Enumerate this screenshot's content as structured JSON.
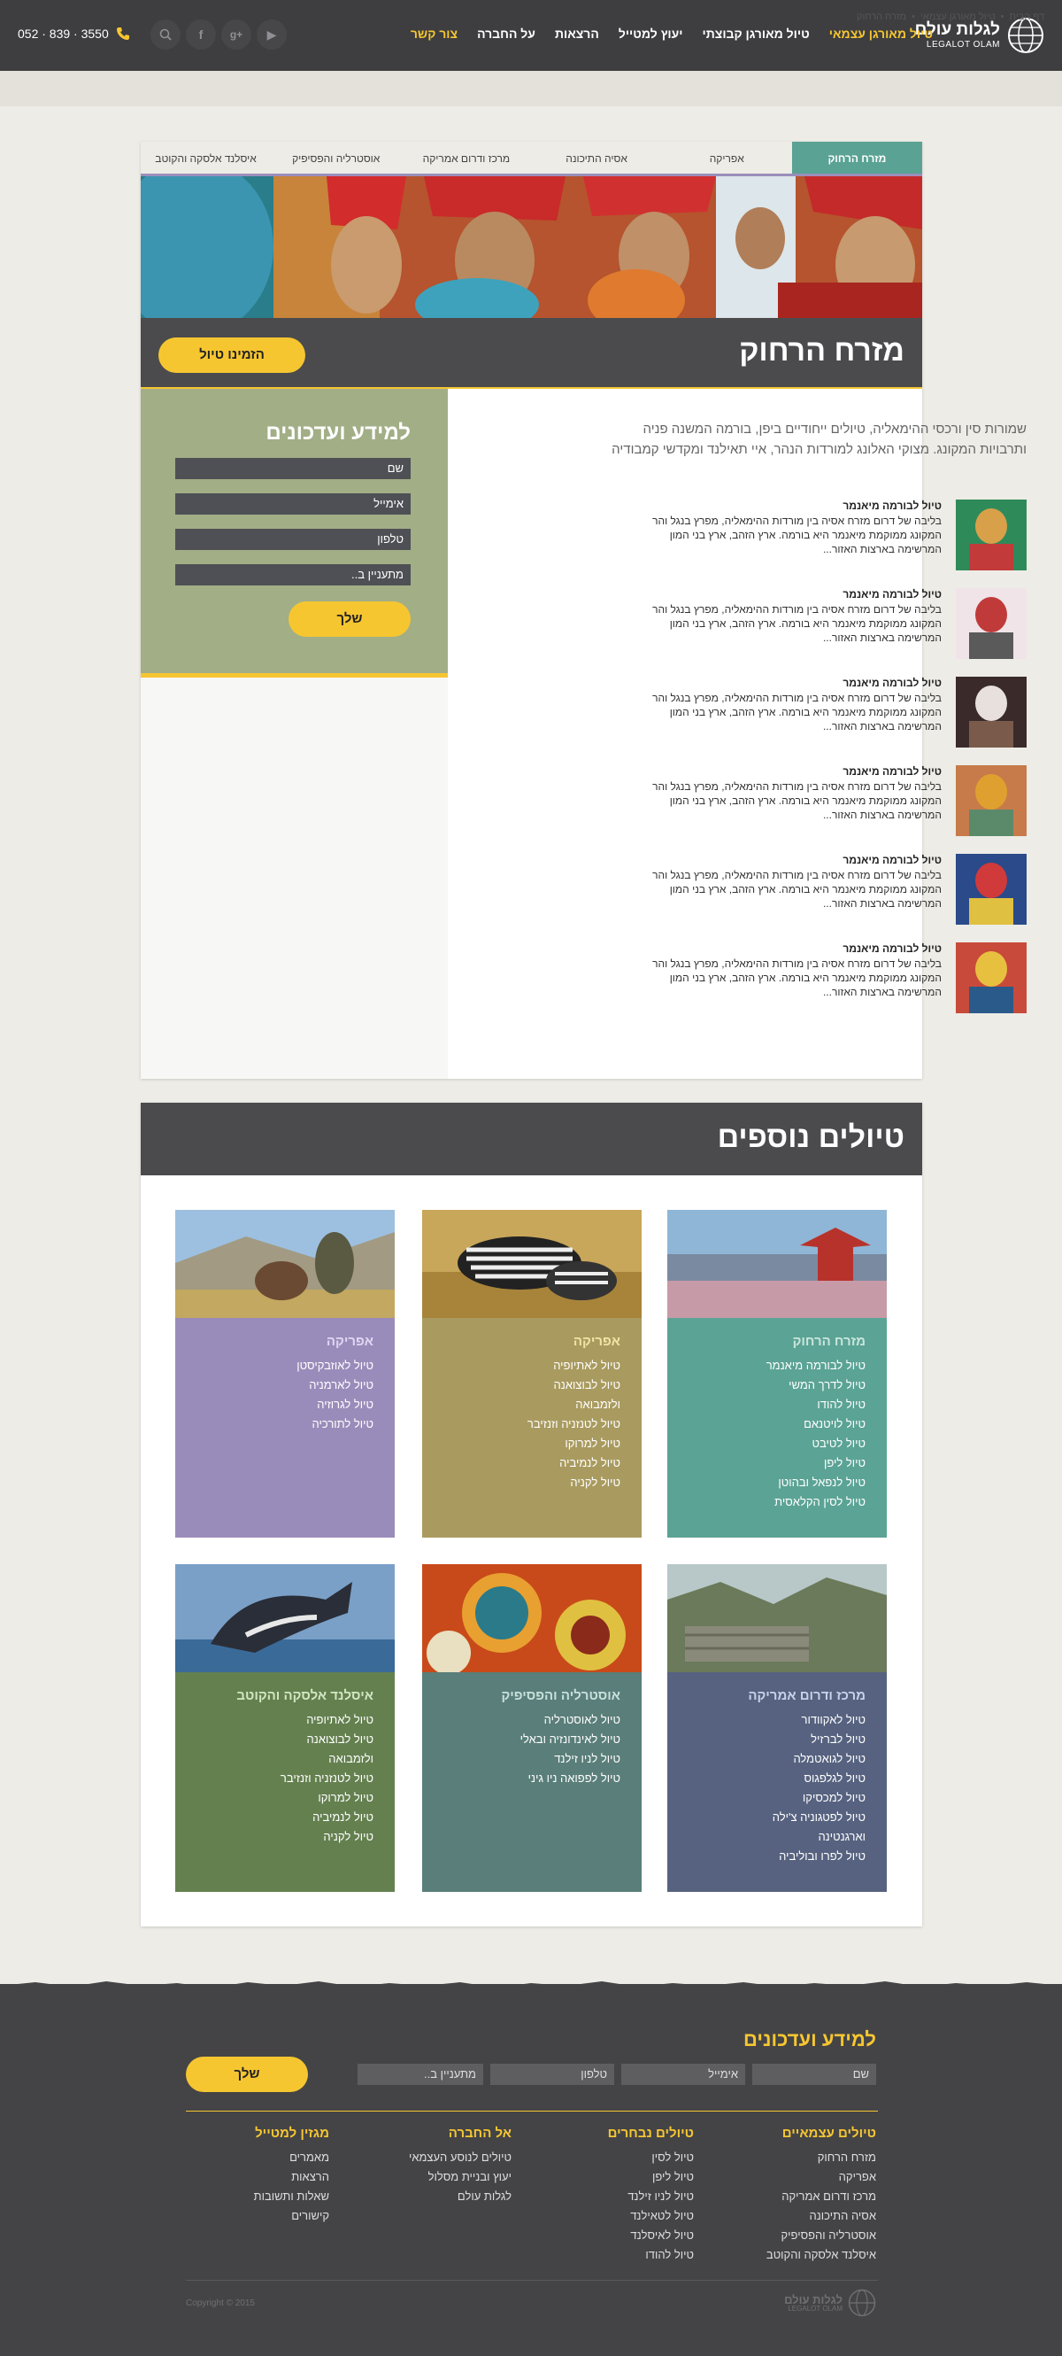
{
  "header": {
    "logo_he": "לגלות עולם",
    "logo_en": "LEGALOT OLAM",
    "nav": [
      "טיול מאורגן עצמאי",
      "טיול מאורגן קבוצתי",
      "יעוץ למטייל",
      "הרצאות",
      "על החברה",
      "צור קשר"
    ],
    "phone": "052 · 839 · 3550",
    "social": [
      "search-icon",
      "facebook-icon",
      "google-plus-icon",
      "youtube-icon"
    ]
  },
  "breadcrumb": [
    "דף הבית",
    "טיול מאורגן עצמאי",
    "מזרח הרחוק"
  ],
  "tabs": [
    "מזרח הרחוק",
    "אפריקה",
    "אסיה התיכונה",
    "מרכז ודרום אמריקה",
    "אוסטרליה והפסיפיק",
    "איסלנד אלסקה והקוטב"
  ],
  "page": {
    "title": "מזרח הרחוק",
    "book_label": "הזמינו טיול",
    "intro": "שמורות סין ורכסי ההימאליה, טיולים ייחודיים ביפן, בורמה המשנה פניה ותרבויות המקונג. מצוקי האלונג למורדות הנהר, איי תאילנד ומקדשי קמבודיה"
  },
  "tour_items": [
    {
      "title": "טיול לבורמה מיאנמר",
      "desc": "בליבה של דרום מזרח אסיה בין מורדות ההימאליה, מפרץ בנגל והר המקונג ממוקמת מיאנמר היא בורמה. ארץ הזהב, ארץ בני המון המרשימה בארצות האזור..."
    },
    {
      "title": "טיול לבורמה מיאנמר",
      "desc": "בליבה של דרום מזרח אסיה בין מורדות ההימאליה, מפרץ בנגל והר המקונג ממוקמת מיאנמר היא בורמה. ארץ הזהב, ארץ בני המון המרשימה בארצות האזור..."
    },
    {
      "title": "טיול לבורמה מיאנמר",
      "desc": "בליבה של דרום מזרח אסיה בין מורדות ההימאליה, מפרץ בנגל והר המקונג ממוקמת מיאנמר היא בורמה. ארץ הזהב, ארץ בני המון המרשימה בארצות האזור..."
    },
    {
      "title": "טיול לבורמה מיאנמר",
      "desc": "בליבה של דרום מזרח אסיה בין מורדות ההימאליה, מפרץ בנגל והר המקונג ממוקמת מיאנמר היא בורמה. ארץ הזהב, ארץ בני המון המרשימה בארצות האזור..."
    },
    {
      "title": "טיול לבורמה מיאנמר",
      "desc": "בליבה של דרום מזרח אסיה בין מורדות ההימאליה, מפרץ בנגל והר המקונג ממוקמת מיאנמר היא בורמה. ארץ הזהב, ארץ בני המון המרשימה בארצות האזור..."
    },
    {
      "title": "טיול לבורמה מיאנמר",
      "desc": "בליבה של דרום מזרח אסיה בין מורדות ההימאליה, מפרץ בנגל והר המקונג ממוקמת מיאנמר היא בורמה. ארץ הזהב, ארץ בני המון המרשימה בארצות האזור..."
    }
  ],
  "form": {
    "title": "למידע ועדכונים",
    "fields": [
      "שם",
      "אימייל",
      "טלפון",
      "מתעניין ב.."
    ],
    "send": "שלך"
  },
  "more": {
    "title": "טיולים נוספים",
    "cards": [
      {
        "title": "מזרח הרחוק",
        "color": "#5ba395",
        "title_color": "#c9e6dc",
        "items": [
          "טיול לבורמה מיאנמר",
          "טיול לדרך המשי",
          "טיול להודו",
          "טיול לויטנאם",
          "טיול לטיבט",
          "טיול ליפן",
          "טיול לנפאל ובהוטן",
          "טיול לסין הקלאסית"
        ]
      },
      {
        "title": "אפריקה",
        "color": "#a99b5f",
        "title_color": "#f1e3a3",
        "items": [
          "טיול לאתיופיה",
          "טיול לבוצואנה",
          "ולזמבואה",
          "טיול לטנזניה וזנזיבר",
          "טיול למרוקו",
          "טיול לנמיביה",
          "טיול לקניה"
        ]
      },
      {
        "title": "אפריקה",
        "color": "#9a8cba",
        "title_color": "#e0d6f2",
        "items": [
          "טיול לאוזבקיסטן",
          "טיול לארמניה",
          "טיול לגרוזיה",
          "טיול לתורכיה"
        ]
      },
      {
        "title": "מרכז ודרום אמריקה",
        "color": "#56627f",
        "title_color": "#c8d2ec",
        "items": [
          "טיול לאקוודור",
          "טיול לברזיל",
          "טיול לגואטמלה",
          "טיול לגלפגוס",
          "טיול למכסיקו",
          "טיול לפטגוניה צ'ילה",
          "וארגנטינה",
          "טיול לפרו ובוליביה"
        ]
      },
      {
        "title": "אוסטרליה והפסיפיק",
        "color": "#5a7e7a",
        "title_color": "#c7e0dc",
        "items": [
          "טיול לאוסטרליה",
          "טיול לאינדונזיה ובאלי",
          "טיול לניו זילנד",
          "טיול לפפואה ניו גיני"
        ]
      },
      {
        "title": "איסלנד אלסקה והקוטב",
        "color": "#64804f",
        "title_color": "#d2e6c2",
        "items": [
          "טיול לאתיופיה",
          "טיול לבוצואנה",
          "ולזמבואה",
          "טיול לטנזניה וזנזיבר",
          "טיול למרוקו",
          "טיול לנמיביה",
          "טיול לקניה"
        ]
      }
    ]
  },
  "footer": {
    "title": "למידע ועדכונים",
    "fields": [
      "שם",
      "אימייל",
      "טלפון",
      "מתעניין ב.."
    ],
    "send": "שלך",
    "cols": [
      {
        "title": "טיולים עצמאיים",
        "items": [
          "מזרח הרחוק",
          "אפריקה",
          "מרכז ודרום אמריקה",
          "אסיה התיכונה",
          "אוסטרליה והפסיפיק",
          "איסלנד אלסקה והקוטב"
        ]
      },
      {
        "title": "טיולים נבחרים",
        "items": [
          "טיול לסין",
          "טיול ליפן",
          "טיול לניו זילנד",
          "טיול לטאילנד",
          "טיול לאיסלנד",
          "טיול להודו"
        ]
      },
      {
        "title": "אל החברה",
        "items": [
          "טיולים לנוסע העצמאי",
          "יעוץ ובניית מסלול",
          "לגלות עולם"
        ]
      },
      {
        "title": "מגזין למטייל",
        "items": [
          "מאמרים",
          "הרצאות",
          "שאלות ותשובות",
          "קישורים"
        ]
      }
    ],
    "logo_he": "לגלות עולם",
    "logo_en": "LEGALOT OLAM",
    "copyright": "Copyright © 2015"
  },
  "colors": {
    "accent": "#f6c631",
    "header": "#3e3e40",
    "tab_active": "#5aa294"
  }
}
